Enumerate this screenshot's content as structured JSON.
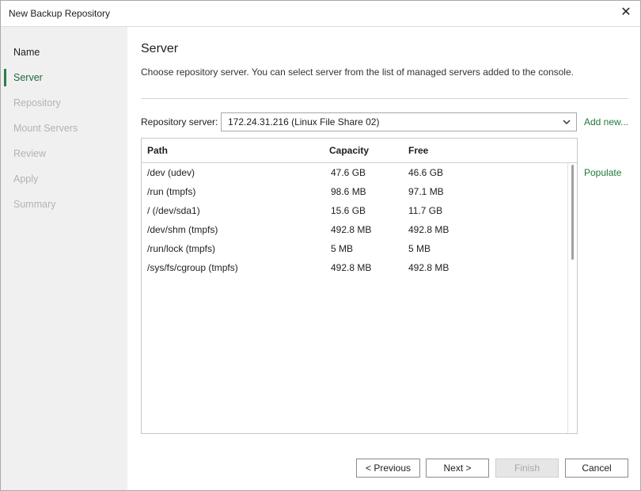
{
  "window": {
    "title": "New Backup Repository"
  },
  "steps": [
    {
      "label": "Name",
      "state": "done"
    },
    {
      "label": "Server",
      "state": "active"
    },
    {
      "label": "Repository",
      "state": "pending"
    },
    {
      "label": "Mount Servers",
      "state": "pending"
    },
    {
      "label": "Review",
      "state": "pending"
    },
    {
      "label": "Apply",
      "state": "pending"
    },
    {
      "label": "Summary",
      "state": "pending"
    }
  ],
  "page": {
    "title": "Server",
    "description": "Choose repository server. You can select server from the list of managed servers added to the console."
  },
  "server": {
    "label": "Repository server:",
    "selected": "172.24.31.216 (Linux File Share 02)",
    "add_new": "Add new...",
    "populate": "Populate"
  },
  "table": {
    "headers": [
      "Path",
      "Capacity",
      "Free"
    ],
    "rows": [
      [
        "/dev (udev)",
        "47.6 GB",
        "46.6 GB"
      ],
      [
        "/run (tmpfs)",
        "98.6 MB",
        "97.1 MB"
      ],
      [
        "/ (/dev/sda1)",
        "15.6 GB",
        "11.7 GB"
      ],
      [
        "/dev/shm (tmpfs)",
        "492.8 MB",
        "492.8 MB"
      ],
      [
        "/run/lock (tmpfs)",
        "5 MB",
        "5 MB"
      ],
      [
        "/sys/fs/cgroup (tmpfs)",
        "492.8 MB",
        "492.8 MB"
      ]
    ]
  },
  "buttons": {
    "previous": "< Previous",
    "next": "Next >",
    "finish": "Finish",
    "cancel": "Cancel"
  },
  "colors": {
    "accent": "#1d7a3c",
    "sidebar_bg": "#f0f0f0"
  }
}
